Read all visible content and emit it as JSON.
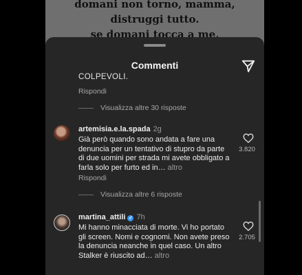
{
  "backdrop": {
    "line1": "domani non torno, mamma,",
    "line2": "distruggi tutto.",
    "line3": "se domani tocca a me,"
  },
  "sheet": {
    "title": "Commenti",
    "send_icon": "send-paper-plane-icon"
  },
  "previous_comment": {
    "text_tail": "COLPEVOLI.",
    "reply_label": "Rispondi",
    "more_replies": "Visualizza altre 30 risposte"
  },
  "comments": [
    {
      "username": "artemisia.e.la.spada",
      "time": "2g",
      "text": "Già però quando sono andata a fare una denuncia per un tentativo di stupro da parte di due uomini per strada mi avete obbligato a farla solo per furto ed in…",
      "more_label": "altro",
      "likes": "3.820",
      "reply_label": "Rispondi",
      "more_replies": "Visualizza altre 6 risposte",
      "verified": false
    },
    {
      "username": "martina_attili",
      "time": "7h",
      "text": "Mi hanno minacciata di morte. Vi ho portato gli screen. Nomi e cognomi. Non avete preso la denuncia neanche in quel caso. Un altro Stalker è riuscito ad…",
      "more_label": "altro",
      "likes": "2.705",
      "verified": true,
      "verified_glyph": "✓"
    }
  ],
  "colors": {
    "sheet_bg": "#262626",
    "muted_text": "#a8a8a8",
    "verified_badge": "#3d97f0"
  }
}
